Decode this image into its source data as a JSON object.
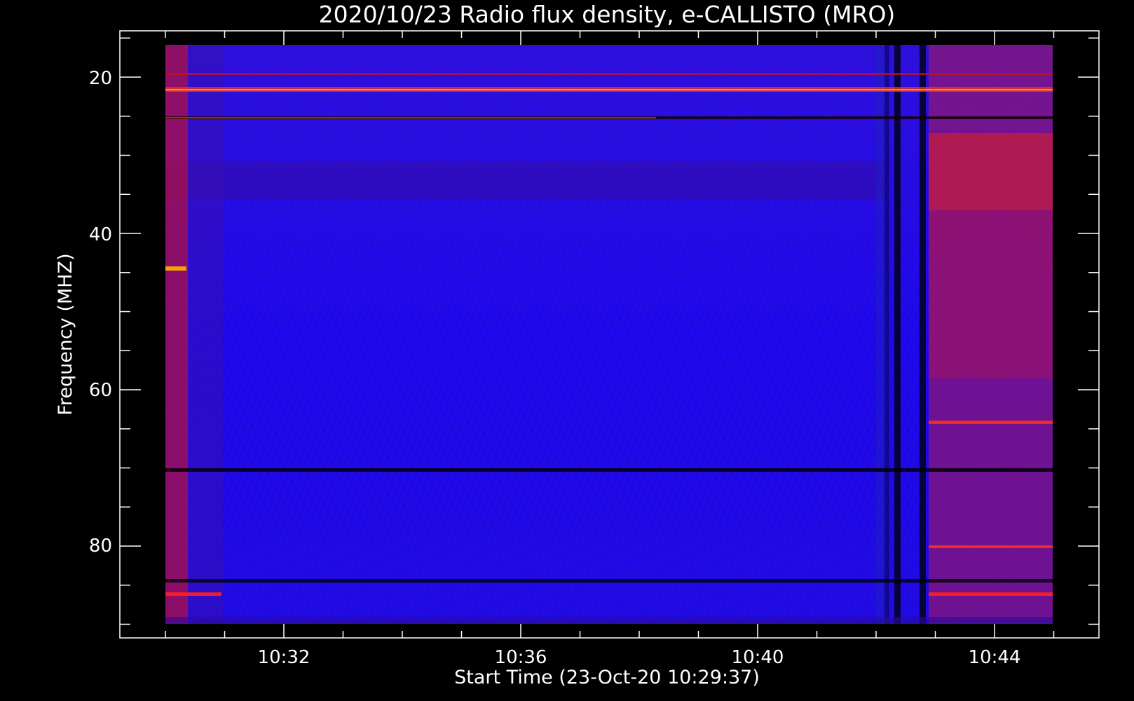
{
  "chart_data": {
    "type": "heatmap",
    "title": "2020/10/23  Radio flux density, e-CALLISTO (MRO)",
    "xlabel": "Start Time (23-Oct-20 10:29:37)",
    "ylabel": "Frequency (MHZ)",
    "x_ticks": [
      "10:32",
      "10:36",
      "10:40",
      "10:44"
    ],
    "y_ticks": [
      "20",
      "40",
      "60",
      "80"
    ],
    "x_range_minutes": [
      10.5,
      10.75
    ],
    "y_range_mhz": [
      14,
      92
    ],
    "y_inverted": true,
    "colormap": [
      "#000000",
      "#0000ff",
      "#ff0000",
      "#ffff00",
      "#ffffff"
    ],
    "background": "#0000ff",
    "features": {
      "bright_frequency_bands_mhz": [
        21,
        25,
        44,
        64.5,
        80.5,
        86
      ],
      "dark_frequency_bands_mhz": [
        70.5,
        85
      ],
      "dark_vertical_lanes": [
        "10:42:25",
        "10:42:50"
      ],
      "enhanced_region_after": "10:43:00"
    }
  },
  "colors": {
    "frame": "#ffffff",
    "page_background": "#000000"
  }
}
